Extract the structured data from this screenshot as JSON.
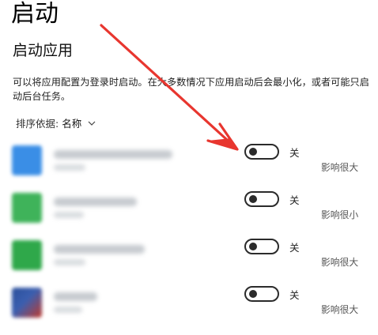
{
  "page": {
    "title": "启动",
    "section_title": "启动应用",
    "description": "可以将应用配置为登录时启动。在大多数情况下应用启动后会最小化，或者可能只启动后台任务。",
    "sort_label": "排序依据:",
    "sort_value": "名称"
  },
  "apps": [
    {
      "state": "关",
      "impact": "影响很大",
      "icon_color": "#3a8ee6",
      "enabled": false
    },
    {
      "state": "关",
      "impact": "影响很小",
      "icon_color": "#3fb35a",
      "enabled": false
    },
    {
      "state": "关",
      "impact": "影响很大",
      "icon_color": "#2fa84a",
      "enabled": false
    },
    {
      "state": "关",
      "impact": "影响很大",
      "icon_color": "#2a4f9a",
      "enabled": false
    }
  ],
  "colors": {
    "annotation_arrow": "#e8362f",
    "toggle_off": "#2b2b2b"
  }
}
